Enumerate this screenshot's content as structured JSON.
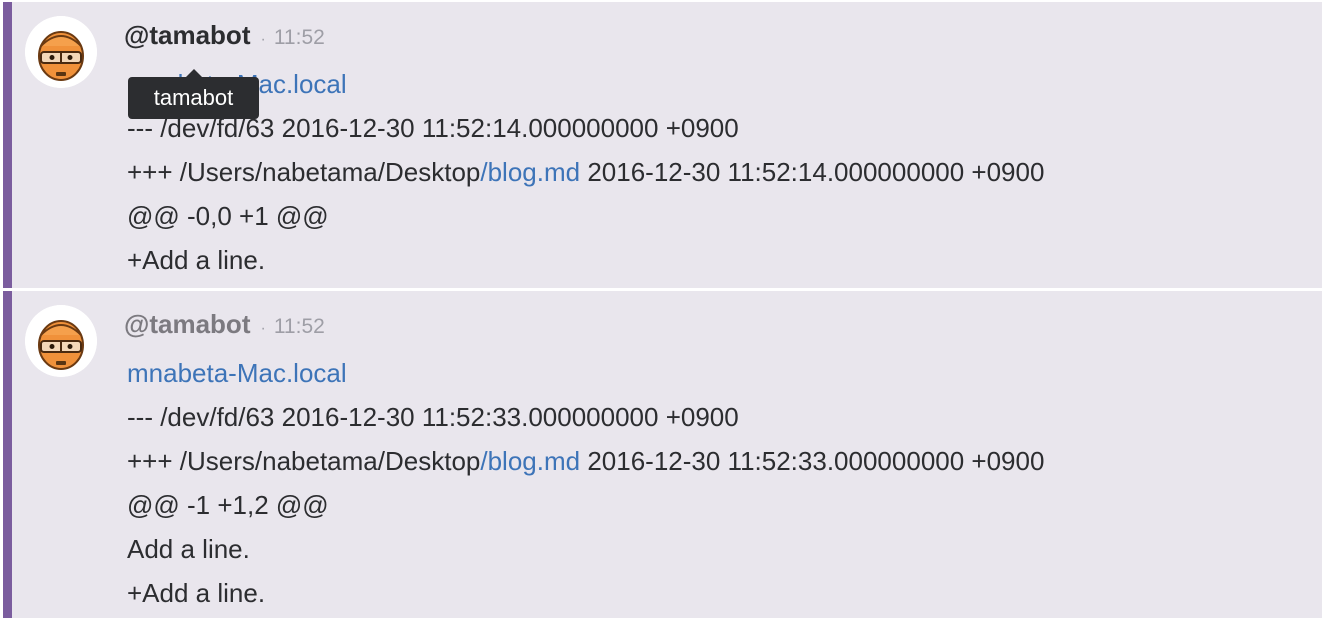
{
  "colors": {
    "accent_bar": "#7b5d9e",
    "message_bg": "#e9e6ed",
    "link": "#3d74b8",
    "timestamp": "#9e9ea6",
    "tooltip_bg": "#2c2d30"
  },
  "tooltip": {
    "text": "tamabot"
  },
  "messages": [
    {
      "avatar_icon": "bot-avatar-icon",
      "username": "@tamabot",
      "separator": "·",
      "time": "11:52",
      "hostname": "mnabeta-Mac.local",
      "minus_header": "--- /dev/fd/63  2016-12-30 11:52:14.000000000 +0900",
      "plus_header_prefix": "+++ /Users/nabetama/Desktop",
      "plus_header_link": "/blog.md",
      "plus_header_suffix": "  2016-12-30 11:52:14.000000000 +0900",
      "hunk": "@@ -0,0 +1 @@",
      "diff_lines": [
        "+Add a line."
      ]
    },
    {
      "avatar_icon": "bot-avatar-icon",
      "username": "@tamabot",
      "separator": "·",
      "time": "11:52",
      "hostname": "mnabeta-Mac.local",
      "minus_header": "--- /dev/fd/63  2016-12-30 11:52:33.000000000 +0900",
      "plus_header_prefix": "+++ /Users/nabetama/Desktop",
      "plus_header_link": "/blog.md",
      "plus_header_suffix": "  2016-12-30 11:52:33.000000000 +0900",
      "hunk": "@@ -1 +1,2 @@",
      "diff_lines": [
        "Add a line.",
        "+Add a line."
      ]
    }
  ]
}
